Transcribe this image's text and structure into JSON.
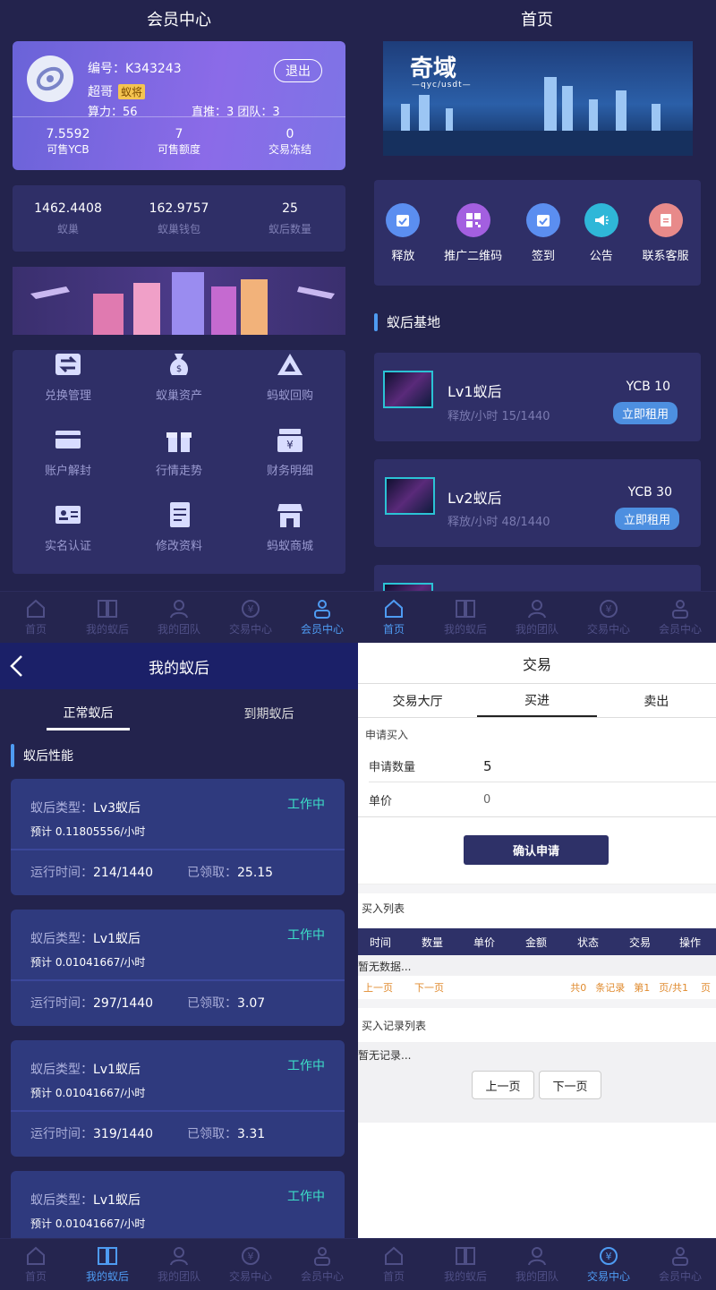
{
  "panel1": {
    "title": "会员中心",
    "profile": {
      "id_label": "编号：K343243",
      "name": "超哥",
      "badge": "蚁将",
      "power": "算力：56",
      "team": "直推：3 团队：3",
      "logout": "退出",
      "stats": [
        {
          "value": "7.5592",
          "label": "可售YCB"
        },
        {
          "value": "7",
          "label": "可售额度"
        },
        {
          "value": "0",
          "label": "交易冻结"
        }
      ]
    },
    "stats2": [
      {
        "value": "1462.4408",
        "label": "蚁巢"
      },
      {
        "value": "162.9757",
        "label": "蚁巢钱包"
      },
      {
        "value": "25",
        "label": "蚁后数量"
      }
    ],
    "menu": [
      {
        "label": "兑换管理",
        "icon": "exchange-icon"
      },
      {
        "label": "蚁巢资产",
        "icon": "money-bag-icon"
      },
      {
        "label": "蚂蚁回购",
        "icon": "triangle-logo-icon"
      },
      {
        "label": "账户解封",
        "icon": "card-icon"
      },
      {
        "label": "行情走势",
        "icon": "gift-icon"
      },
      {
        "label": "财务明细",
        "icon": "cash-register-icon"
      },
      {
        "label": "实名认证",
        "icon": "id-card-icon"
      },
      {
        "label": "修改资料",
        "icon": "document-icon"
      },
      {
        "label": "蚂蚁商城",
        "icon": "store-icon"
      }
    ]
  },
  "panel2": {
    "title": "首页",
    "banner": {
      "brand": "奇域",
      "sub": "—qyc/usdt—"
    },
    "shortcuts": [
      {
        "label": "释放",
        "color": "#5b8ef0"
      },
      {
        "label": "推广二维码",
        "color": "#a35fe0"
      },
      {
        "label": "签到",
        "color": "#5b8ef0"
      },
      {
        "label": "公告",
        "color": "#2fb7d8"
      },
      {
        "label": "联系客服",
        "color": "#e88a8a"
      }
    ],
    "section": "蚁后基地",
    "queens": [
      {
        "name": "Lv1蚁后",
        "rate": "释放/小时 15/1440",
        "price": "YCB 10",
        "action": "立即租用"
      },
      {
        "name": "Lv2蚁后",
        "rate": "释放/小时 48/1440",
        "price": "YCB 30",
        "action": "立即租用"
      }
    ]
  },
  "panel3": {
    "title": "我的蚁后",
    "tabs": [
      "正常蚁后",
      "到期蚁后"
    ],
    "section": "蚁后性能",
    "cards": [
      {
        "type_label": "蚁后类型：",
        "type": "Lv3蚁后",
        "status": "工作中",
        "estimate": "预计 0.11805556/小时",
        "run_label": "运行时间：",
        "run": "214/1440",
        "got_label": "已领取：",
        "got": "25.15"
      },
      {
        "type_label": "蚁后类型：",
        "type": "Lv1蚁后",
        "status": "工作中",
        "estimate": "预计 0.01041667/小时",
        "run_label": "运行时间：",
        "run": "297/1440",
        "got_label": "已领取：",
        "got": "3.07"
      },
      {
        "type_label": "蚁后类型：",
        "type": "Lv1蚁后",
        "status": "工作中",
        "estimate": "预计 0.01041667/小时",
        "run_label": "运行时间：",
        "run": "319/1440",
        "got_label": "已领取：",
        "got": "3.31"
      },
      {
        "type_label": "蚁后类型：",
        "type": "Lv1蚁后",
        "status": "工作中",
        "estimate": "预计 0.01041667/小时",
        "run_label": "",
        "run": "",
        "got_label": "",
        "got": ""
      }
    ]
  },
  "panel4": {
    "title": "交易",
    "tabs": [
      "交易大厅",
      "买进",
      "卖出"
    ],
    "form_title": "申请买入",
    "qty_label": "申请数量",
    "qty_value": "5",
    "price_label": "单价",
    "price_value": "0",
    "submit": "确认申请",
    "list_title": "买入列表",
    "columns": [
      "时间",
      "数量",
      "单价",
      "金额",
      "状态",
      "交易",
      "操作"
    ],
    "no_data": "暂无数据...",
    "pager": {
      "prev": "上一页",
      "next": "下一页",
      "total": "共0",
      "records": "条记录",
      "page": "第1",
      "pages": "页/共1",
      "unit": "页"
    },
    "record_title": "买入记录列表",
    "no_record": "暂无记录...",
    "prev_btn": "上一页",
    "next_btn": "下一页"
  },
  "tabbar": [
    "首页",
    "我的蚁后",
    "我的团队",
    "交易中心",
    "会员中心"
  ]
}
